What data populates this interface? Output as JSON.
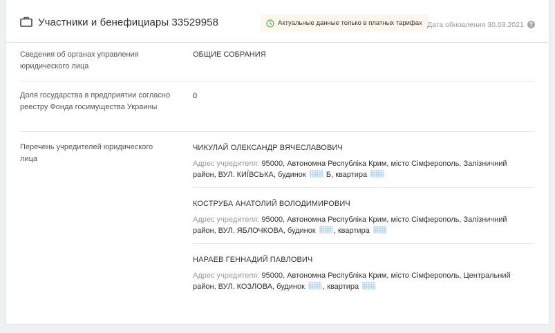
{
  "header": {
    "title": "Участники и бенефициары 33529958",
    "badge_text": "Актуальные данные только в платных тарифах",
    "updated_text": "Дата обновления 30.03.2021",
    "help_glyph": "?",
    "icon": "briefcase-icon",
    "badge_icon": "clock-icon",
    "badge_color": "#fff7ee"
  },
  "rows": [
    {
      "label": "Сведения об органах управления юридического лица",
      "value": "ОБЩИЕ СОБРАНИЯ"
    },
    {
      "label": "Доля государства в предприятии согласно реестру Фонда госимущества Украины",
      "value": "0"
    },
    {
      "label": "Перечень учредителей юридического лица"
    }
  ],
  "founders": [
    {
      "name": "ЧИКУЛАЙ ОЛЕКСАНДР ВЯЧЕСЛАВОВИЧ",
      "address_label": "Адрес учредителя:",
      "address_main": "95000, Автономна Республіка Крим, місто Сімферополь, Залізничний район, ВУЛ. КИЇВСЬКА, будинок",
      "house_suffix": "Б,",
      "apartment_label": "квартира"
    },
    {
      "name": "КОСТРУБА АНАТОЛИЙ ВОЛОДИМИРОВИЧ",
      "address_label": "Адрес учредителя:",
      "address_main": "95000, Автономна Республіка Крим, місто Сімферополь, Залізничний район, ВУЛ. ЯБЛОЧКОВА, будинок",
      "house_suffix": ",",
      "apartment_label": "квартира"
    },
    {
      "name": "НАРАЕВ ГЕННАДИЙ ПАВЛОВИЧ",
      "address_label": "Адрес учредителя:",
      "address_main": "95000, Автономна Республіка Крим, місто Сімферополь, Центральний район, ВУЛ. КОЗЛОВА, будинок",
      "house_suffix": ",",
      "apartment_label": "квартира"
    }
  ]
}
